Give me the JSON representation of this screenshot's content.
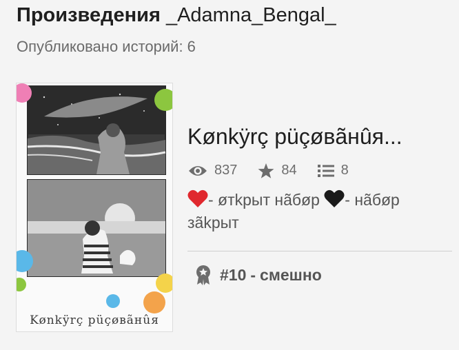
{
  "header": {
    "title_prefix": "Произведения",
    "username": "_Adamna_Bengal_",
    "published_label": "Опубликовано историй: 6"
  },
  "story": {
    "cover_caption": "Kønkÿrç рüçøвãнûя",
    "title": "Kønkÿrç рüçøвãнûя...",
    "stats": {
      "reads": "837",
      "votes": "84",
      "parts": "8"
    },
    "description": {
      "part1": "- øтkрыт нãбøр",
      "part2": "- нãбøр зãkрыт"
    },
    "rank": {
      "position": "#10",
      "separator": "-",
      "tag": "смешно"
    }
  },
  "icons": {
    "reads": "eye-icon",
    "votes": "star-icon",
    "parts": "list-icon",
    "rank": "award-ribbon-icon",
    "heart_red": "red-heart-emoji",
    "heart_black": "black-heart-emoji"
  },
  "colors": {
    "page_background": "#f4f4f4",
    "title_text": "#1f1f1f",
    "secondary_text": "#6a6a6a",
    "heart_red": "#e0282e",
    "heart_black": "#1a1a1a",
    "dot_pink": "#ef7fb5",
    "dot_green": "#8cc63f",
    "dot_blue": "#5ab8e8",
    "dot_orange": "#f3a34b",
    "dot_yellow": "#f4d34a"
  }
}
